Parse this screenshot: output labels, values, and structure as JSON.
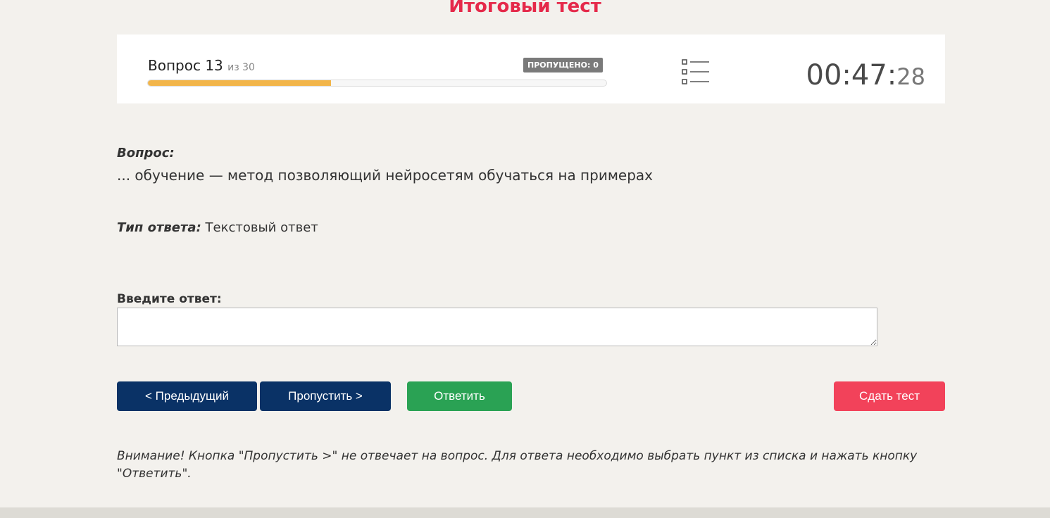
{
  "page_title": "Итоговый тест",
  "status_bar": {
    "question_label": "Вопрос 13",
    "question_of": "из 30",
    "current_question": 13,
    "total_questions": 30,
    "progress_fraction": 0.4,
    "skipped_badge": "ПРОПУЩЕНО: 0",
    "list_icon": "question-list-icon",
    "timer_main": "00:47:",
    "timer_seconds": "28"
  },
  "question": {
    "label": "Вопрос:",
    "text": "... обучение — метод позволяющий нейросетям обучаться на примерах"
  },
  "answer_type": {
    "label": "Тип ответа:",
    "value": "Текстовый ответ"
  },
  "answer_input": {
    "label": "Введите ответ:",
    "value": "",
    "placeholder": ""
  },
  "buttons": {
    "prev": "< Предыдущий",
    "skip": "Пропустить >",
    "answer": "Ответить",
    "submit": "Сдать тест"
  },
  "warning": "Внимание! Кнопка \"Пропустить >\" не отвечает на вопрос. Для ответа необходимо выбрать пункт из списка и нажать кнопку \"Ответить\".",
  "colors": {
    "title": "#e5294a",
    "progress": "#f2b54a",
    "nav_button": "#0a3266",
    "answer_button": "#2aa254",
    "submit_button": "#f2425a"
  }
}
